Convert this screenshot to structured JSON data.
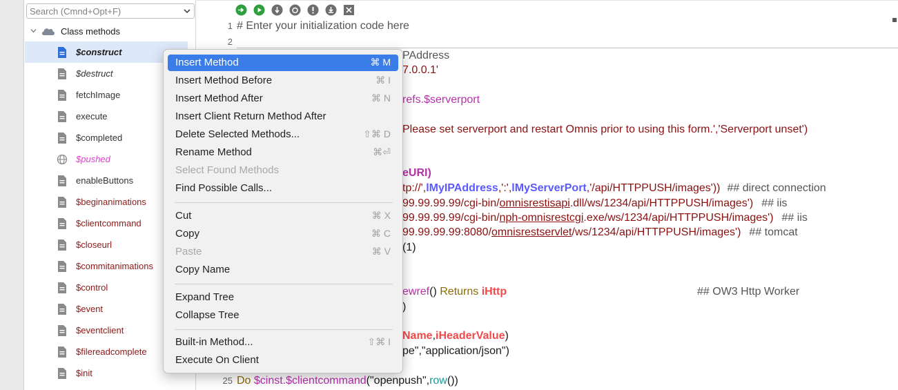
{
  "sidebar": {
    "search_placeholder": "Search (Cmnd+Opt+F)",
    "root_label": "Class methods",
    "items": [
      {
        "label": "$construct",
        "style": "bold"
      },
      {
        "label": "$destruct",
        "style": "italic"
      },
      {
        "label": "fetchImage",
        "style": "plain"
      },
      {
        "label": "execute",
        "style": "plain"
      },
      {
        "label": "$completed",
        "style": "plain"
      },
      {
        "label": "$pushed",
        "style": "pink"
      },
      {
        "label": "enableButtons",
        "style": "plain"
      },
      {
        "label": "$beginanimations",
        "style": "red"
      },
      {
        "label": "$clientcommand",
        "style": "red"
      },
      {
        "label": "$closeurl",
        "style": "red"
      },
      {
        "label": "$commitanimations",
        "style": "red"
      },
      {
        "label": "$control",
        "style": "red"
      },
      {
        "label": "$event",
        "style": "red"
      },
      {
        "label": "$eventclient",
        "style": "red"
      },
      {
        "label": "$filereadcomplete",
        "style": "red"
      },
      {
        "label": "$init",
        "style": "red"
      }
    ]
  },
  "editor": {
    "line_numbers": [
      "1",
      "2",
      "25"
    ],
    "line1": "# Enter your initialization code here",
    "l3": "PAddress",
    "l4": "7.0.0.1'",
    "l6": "refs.$serverport",
    "l8": "Please set serverport and restart Omnis prior to using this form.','Serverport unset')",
    "l11": "eURI)",
    "l12a": "tp://',",
    "l12b": "lMyIPAddress",
    "l12c": ",':',",
    "l12d": "lMyServerPort",
    "l12e": ",'/api/HTTPPUSH/images'))",
    "l12f": "## direct connection",
    "l13a": "99.99.99.99/cgi-bin/",
    "l13b": "omnisrestisapi",
    "l13c": ".dll/ws/1234/api/HTTPPUSH/images')",
    "l13d": "## iis",
    "l14a": "99.99.99.99/cgi-bin/",
    "l14b": "nph-omnisrestcgi",
    "l14c": ".exe/ws/1234/api/HTTPPUSH/images')",
    "l14d": "## iis",
    "l15a": "99.99.99.99:8080/",
    "l15b": "omnisrestservlet",
    "l15c": "/ws/1234/api/HTTPPUSH/images')",
    "l15d": "## tomcat",
    "l16": "(1)",
    "l19a": "ewref",
    "l19b": "() ",
    "l19c": "Returns",
    "l19d": "iHttp",
    "l19e": "## OW3 Http Worker",
    "l20": ")",
    "l22a": "Name",
    "l22b": ",",
    "l22c": "iHeaderValue",
    "l22d": ")",
    "l23": "pe\",\"application/json\")",
    "l25a": "Do ",
    "l25b": "$cinst.$clientcommand",
    "l25c": "(\"openpush\",",
    "l25d": "row",
    "l25e": "())"
  },
  "context_menu": {
    "items": [
      {
        "label": "Insert Method",
        "shortcut": "⌘ M",
        "active": true
      },
      {
        "label": "Insert Method Before",
        "shortcut": "⌘ I"
      },
      {
        "label": "Insert Method After",
        "shortcut": "⌘ N"
      },
      {
        "label": "Insert Client Return Method After",
        "shortcut": ""
      },
      {
        "label": "Delete Selected Methods...",
        "shortcut": "⇧⌘ D"
      },
      {
        "label": "Rename Method",
        "shortcut": "⌘⏎"
      },
      {
        "label": "Select Found Methods",
        "shortcut": "",
        "disabled": true
      },
      {
        "label": "Find Possible Calls...",
        "shortcut": ""
      },
      {
        "label": "Cut",
        "shortcut": "⌘ X"
      },
      {
        "label": "Copy",
        "shortcut": "⌘ C"
      },
      {
        "label": "Paste",
        "shortcut": "⌘ V",
        "disabled": true
      },
      {
        "label": "Copy Name",
        "shortcut": ""
      },
      {
        "label": "Expand Tree",
        "shortcut": ""
      },
      {
        "label": "Collapse Tree",
        "shortcut": ""
      },
      {
        "label": "Built-in Method...",
        "shortcut": "⇧⌘ I"
      },
      {
        "label": "Execute On Client",
        "shortcut": ""
      }
    ]
  },
  "colors": {
    "menu_highlight": "#3b7de8",
    "selected_row": "#dde8f8"
  }
}
